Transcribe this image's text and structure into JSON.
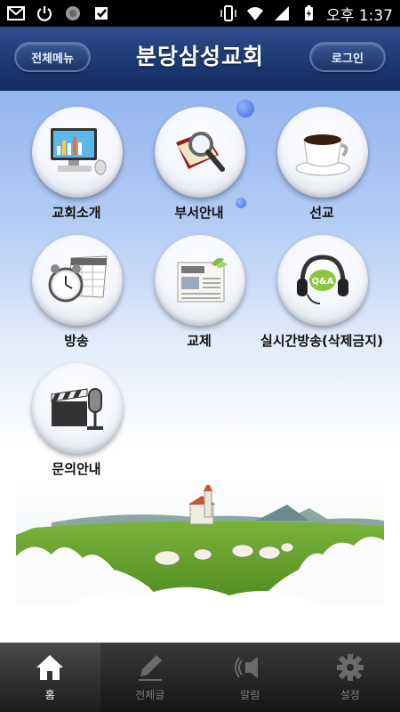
{
  "status_bar": {
    "time": "오후 1:37",
    "icons": [
      "gmail-icon",
      "power-icon",
      "record-icon",
      "check-icon",
      "vibrate-icon",
      "wifi-icon",
      "signal-icon",
      "battery-icon"
    ]
  },
  "header": {
    "menu_label": "전체메뉴",
    "title": "분당삼성교회",
    "login_label": "로그인"
  },
  "menu": {
    "items": [
      {
        "label": "교회소개",
        "icon": "computer-icon"
      },
      {
        "label": "부서안내",
        "icon": "book-magnifier-icon"
      },
      {
        "label": "선교",
        "icon": "coffee-cup-icon"
      },
      {
        "label": "방송",
        "icon": "alarm-clock-calendar-icon"
      },
      {
        "label": "교제",
        "icon": "newspaper-icon"
      },
      {
        "label": "실시간방송(삭제금지)",
        "icon": "headset-qa-icon"
      },
      {
        "label": "문의안내",
        "icon": "clapper-microphone-icon"
      }
    ]
  },
  "bottom_nav": {
    "items": [
      {
        "label": "홈",
        "icon": "home-icon",
        "active": true
      },
      {
        "label": "전체글",
        "icon": "pencil-icon",
        "active": false
      },
      {
        "label": "알림",
        "icon": "speaker-icon",
        "active": false
      },
      {
        "label": "설정",
        "icon": "gear-icon",
        "active": false
      }
    ]
  },
  "colors": {
    "header_bg": "#1e3c78",
    "menu_bg_top": "#93b5ef",
    "nav_bg": "#222222"
  }
}
